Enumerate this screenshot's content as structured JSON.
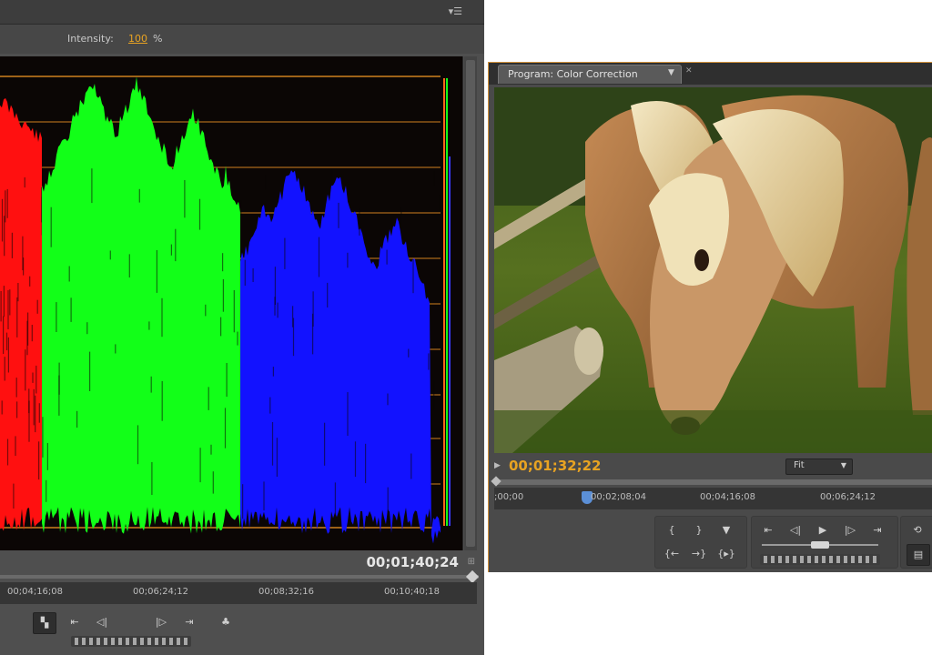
{
  "left_panel": {
    "intensity_label": "Intensity:",
    "intensity_value": "100",
    "intensity_unit": "%",
    "timecode": "00;01;40;24",
    "ruler_ticks": [
      "00;04;16;08",
      "00;06;24;12",
      "00;08;32;16",
      "00;10;40;18"
    ]
  },
  "program_monitor": {
    "tab_label": "Program: Color Correction",
    "timecode": "00;01;32;22",
    "fit_value": "Fit",
    "ruler_ticks": [
      ";00;00",
      "00;02;08;04",
      "00;04;16;08",
      "00;06;24;12"
    ]
  },
  "colors": {
    "panel_bg": "#4f4f4f",
    "timecode_accent": "#e8a322",
    "scope_bg": "#0b0605",
    "scope_red": "#ff1010",
    "scope_green": "#12ff18",
    "scope_blue": "#1212ff",
    "graticule": "#d0801e"
  },
  "icons": [
    "panel-menu-icon",
    "mark-in-icon",
    "mark-out-icon",
    "step-back-icon",
    "play-icon",
    "step-forward-icon",
    "go-to-in-icon",
    "go-to-out-icon",
    "export-frame-icon",
    "loop-icon",
    "safe-margins-icon",
    "output-icon",
    "lift-icon",
    "extract-icon",
    "playhead-marker-icon"
  ]
}
